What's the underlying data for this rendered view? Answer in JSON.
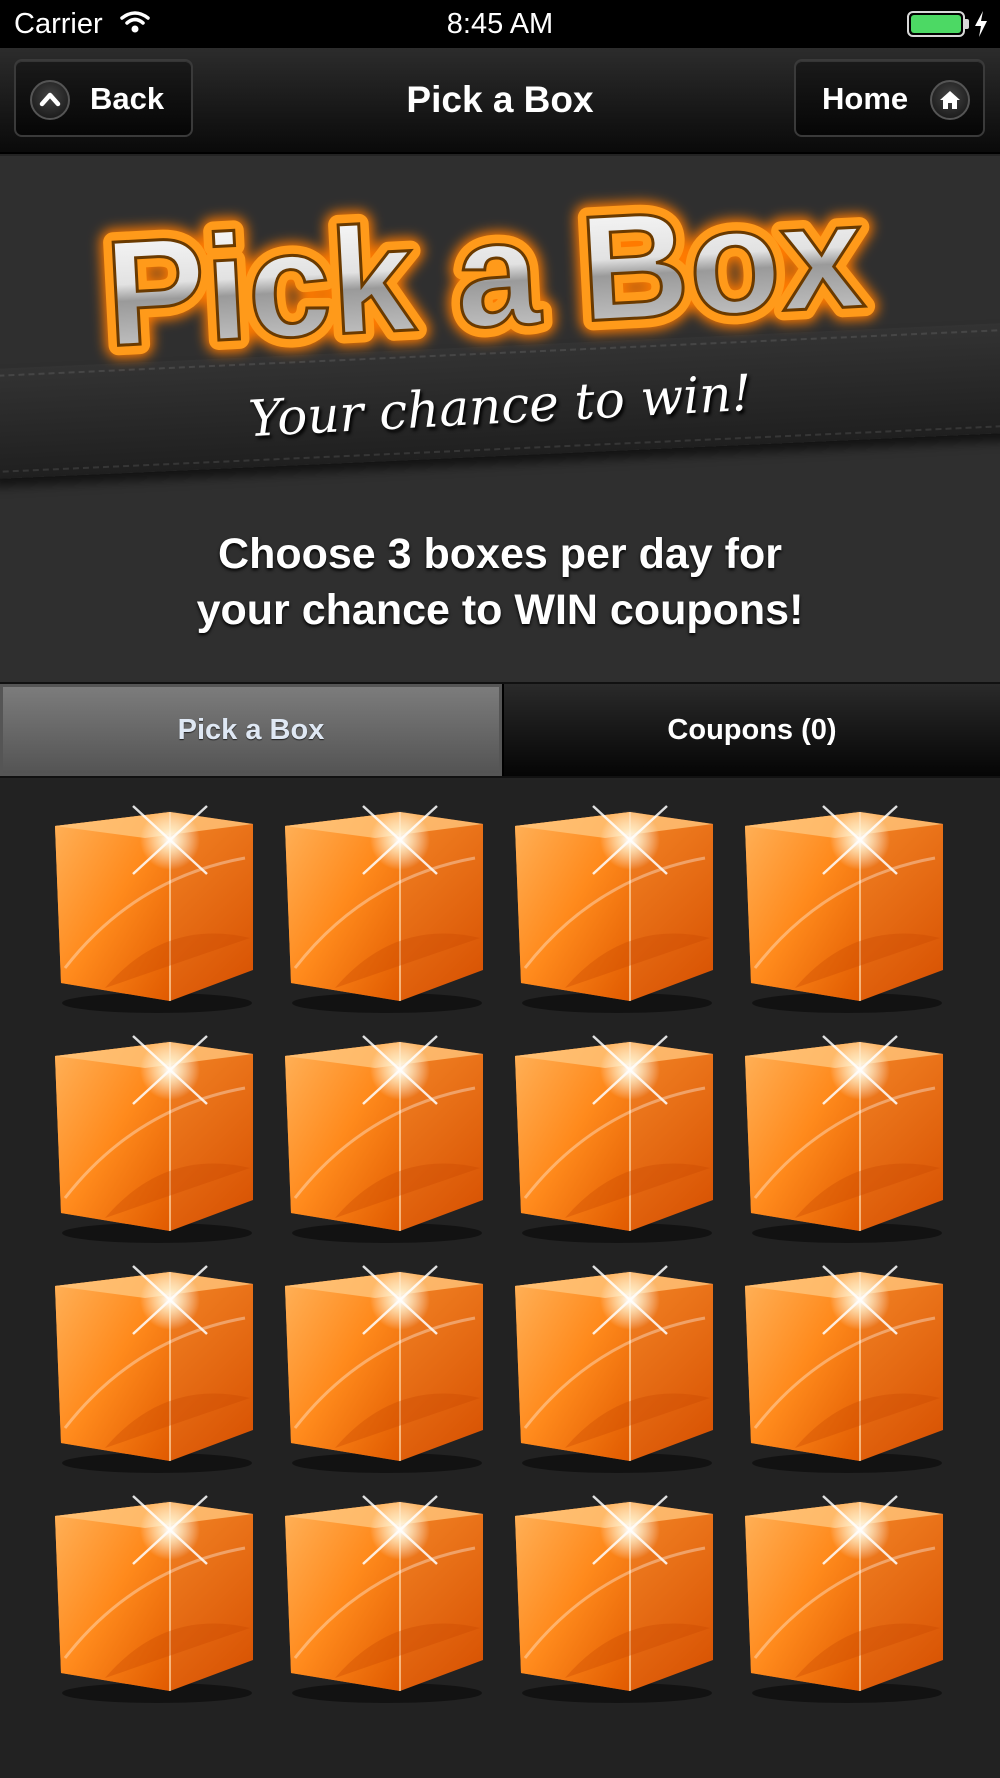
{
  "status_bar": {
    "carrier": "Carrier",
    "time": "8:45 AM",
    "battery_level": 1.0,
    "battery_color": "#4cd964"
  },
  "nav": {
    "title": "Pick a Box",
    "back_label": "Back",
    "home_label": "Home",
    "back_icon": "chevron-up-icon",
    "home_icon": "house-icon"
  },
  "banner": {
    "logo_text": "Pick a Box",
    "tagline": "Your chance to win!",
    "headline_line1": "Choose 3 boxes per day for",
    "headline_line2": "your chance to WIN coupons!"
  },
  "tabs": [
    {
      "label": "Pick a Box",
      "selected": true
    },
    {
      "label": "Coupons (0)",
      "selected": false
    }
  ],
  "grid": {
    "rows": 4,
    "columns": 4,
    "box_count": 16,
    "box_color": "#ff8a1c",
    "box_icon": "orange-gift-box-icon"
  }
}
